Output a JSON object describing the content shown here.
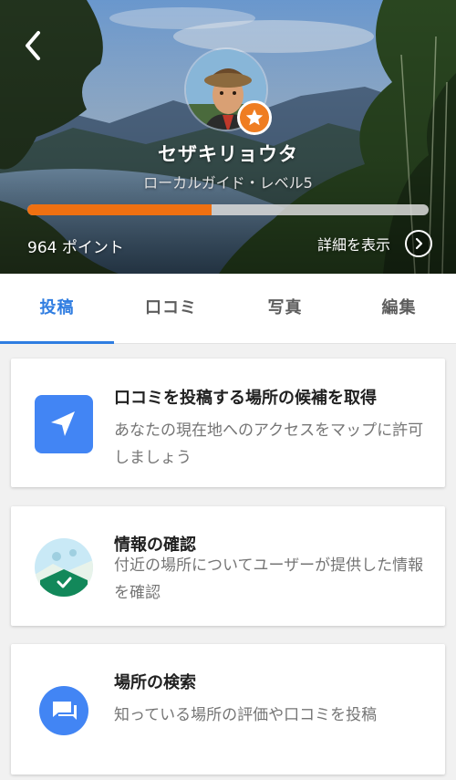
{
  "header": {
    "name": "セザキリョウタ",
    "level": "ローカルガイド・レベル5",
    "points_text": "964 ポイント",
    "progress": 0.46,
    "details_label": "詳細を表示",
    "accent_color": "#ef7011"
  },
  "tabs": [
    {
      "label": "投稿",
      "active": true
    },
    {
      "label": "口コミ",
      "active": false
    },
    {
      "label": "写真",
      "active": false
    },
    {
      "label": "編集",
      "active": false
    }
  ],
  "cards": [
    {
      "icon": "navigation-arrow-icon",
      "title": "口コミを投稿する場所の候補を取得",
      "description": "あなたの現在地へのアクセスをマップに許可しましょう"
    },
    {
      "icon": "map-check-icon",
      "title": "情報の確認",
      "description": "付近の場所についてユーザーが提供した情報を確認"
    },
    {
      "icon": "review-chat-icon",
      "title": "場所の検索",
      "description": "知っている場所の評価や口コミを投稿"
    }
  ],
  "colors": {
    "tab_active": "#2f7de1",
    "icon_blue": "#4285f4",
    "badge_orange": "#ef7d22"
  }
}
